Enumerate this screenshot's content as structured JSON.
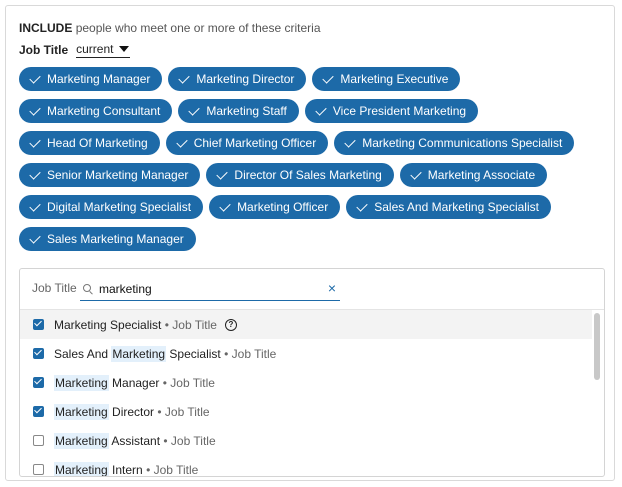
{
  "header": {
    "include_label": "INCLUDE",
    "include_text": "people who meet one or more of these criteria"
  },
  "filter": {
    "label": "Job Title",
    "dropdown_value": "current"
  },
  "chips": [
    "Marketing Manager",
    "Marketing Director",
    "Marketing Executive",
    "Marketing Consultant",
    "Marketing Staff",
    "Vice President Marketing",
    "Head Of Marketing",
    "Chief Marketing Officer",
    "Marketing Communications Specialist",
    "Senior Marketing Manager",
    "Director Of Sales Marketing",
    "Marketing Associate",
    "Digital Marketing Specialist",
    "Marketing Officer",
    "Sales And Marketing Specialist",
    "Sales Marketing Manager"
  ],
  "search": {
    "label": "Job Title",
    "value": "marketing",
    "clear_icon": "×"
  },
  "results": [
    {
      "prefix": "",
      "match": "",
      "suffix": "Marketing Specialist",
      "meta": "• Job Title",
      "checked": true,
      "help": true
    },
    {
      "prefix": "Sales And ",
      "match": "Marketing",
      "suffix": " Specialist",
      "meta": "• Job Title",
      "checked": true,
      "help": false
    },
    {
      "prefix": "",
      "match": "Marketing",
      "suffix": " Manager",
      "meta": "• Job Title",
      "checked": true,
      "help": false
    },
    {
      "prefix": "",
      "match": "Marketing",
      "suffix": " Director",
      "meta": "• Job Title",
      "checked": true,
      "help": false
    },
    {
      "prefix": "",
      "match": "Marketing",
      "suffix": " Assistant",
      "meta": "• Job Title",
      "checked": false,
      "help": false
    },
    {
      "prefix": "",
      "match": "Marketing",
      "suffix": " Intern",
      "meta": "• Job Title",
      "checked": false,
      "help": false
    }
  ],
  "colors": {
    "accent": "#1d6aa8",
    "highlight": "#e3f0fb"
  },
  "icons": {
    "chip_check": "check-icon",
    "search": "search-icon",
    "help": "question-circle-icon"
  }
}
